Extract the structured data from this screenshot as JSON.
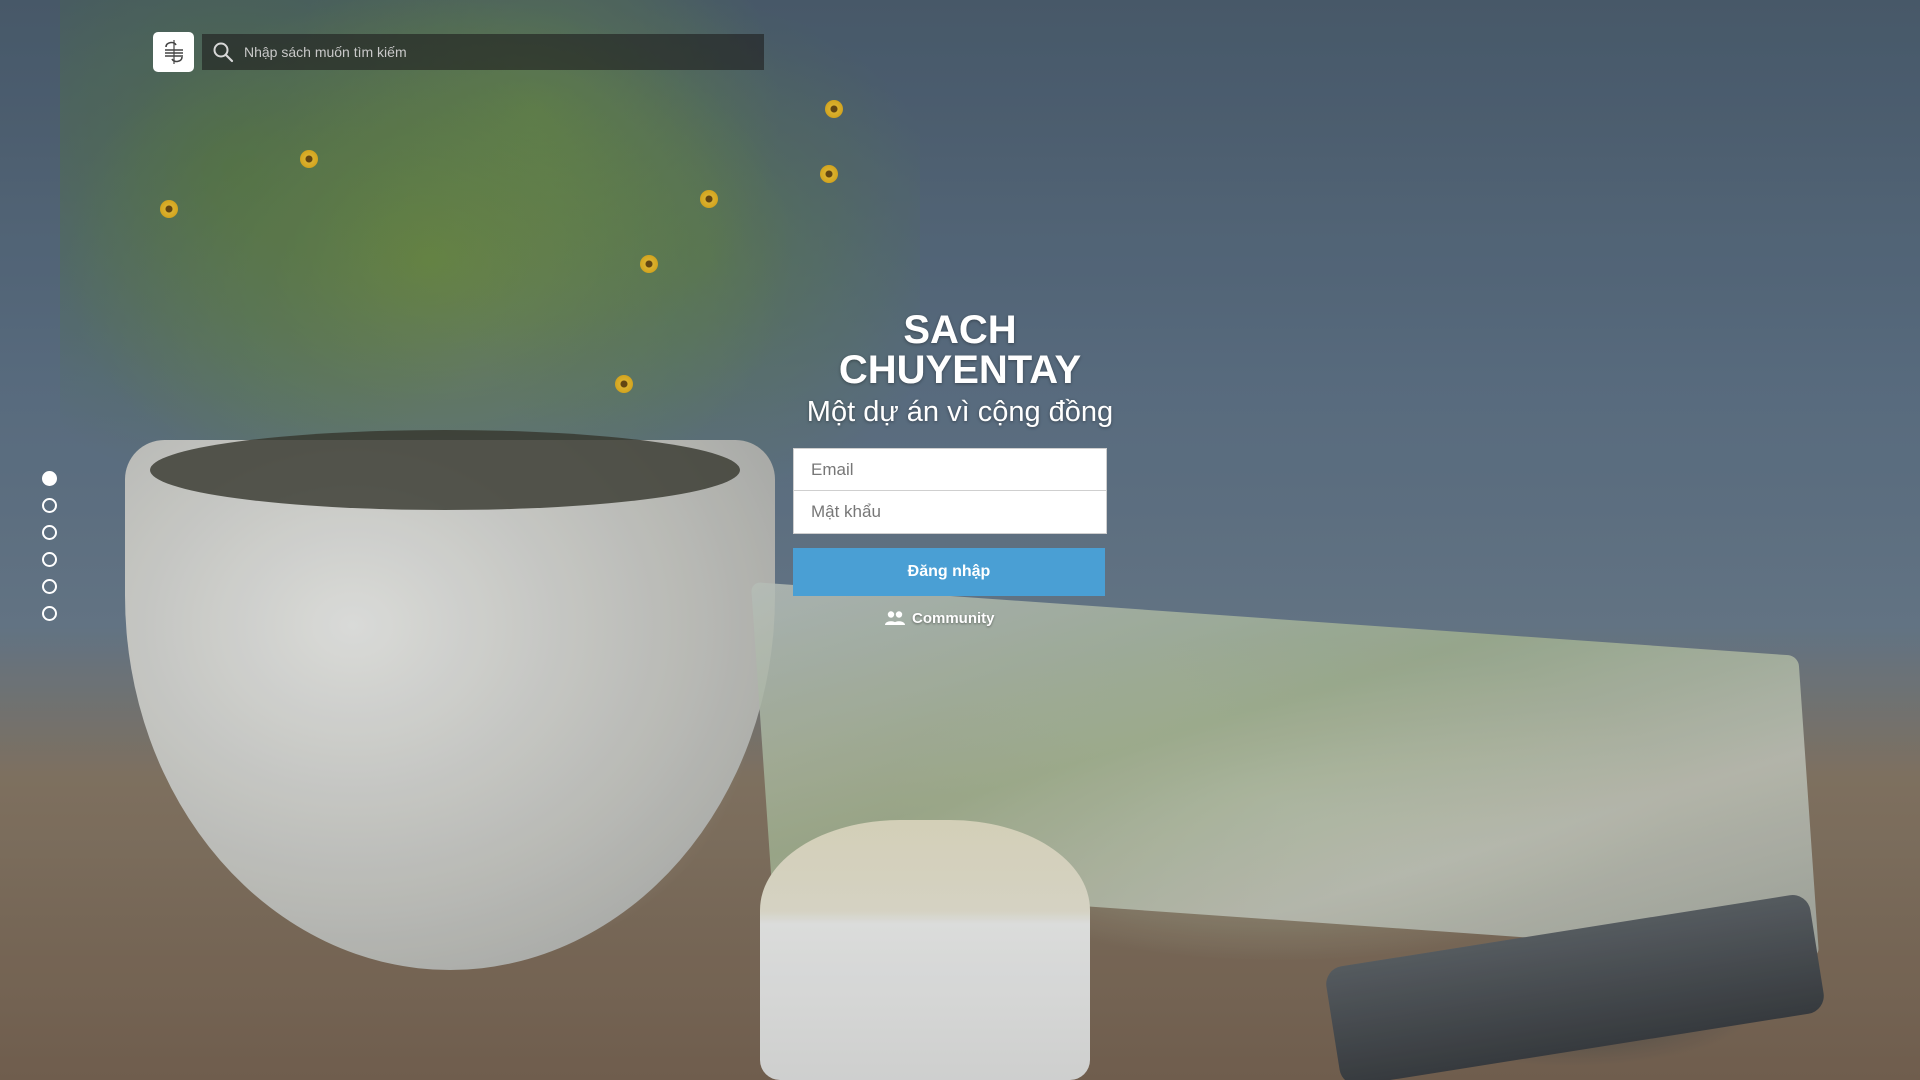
{
  "header": {
    "logo_icon": "book-swap-logo-icon",
    "search": {
      "placeholder": "Nhập sách muốn tìm kiếm",
      "value": ""
    }
  },
  "slider": {
    "count": 6,
    "active_index": 0
  },
  "hero": {
    "brand_line1": "SACH",
    "brand_line2": "CHUYENTAY",
    "tagline": "Một dự án vì cộng đồng"
  },
  "login": {
    "email_placeholder": "Email",
    "password_placeholder": "Mật khẩu",
    "submit_label": "Đăng nhập",
    "accent_color": "#4a9fd4"
  },
  "community": {
    "label": "Community",
    "icon": "users-icon"
  }
}
